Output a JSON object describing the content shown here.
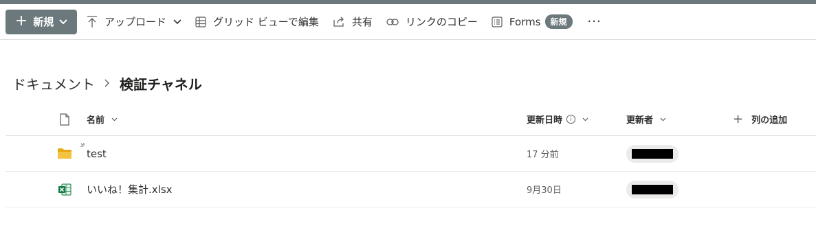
{
  "toolbar": {
    "new_label": "新規",
    "upload_label": "アップロード",
    "grid_label": "グリッド ビューで編集",
    "share_label": "共有",
    "copy_link_label": "リンクのコピー",
    "forms_label": "Forms",
    "forms_badge": "新規",
    "more_label": "···"
  },
  "breadcrumb": {
    "root": "ドキュメント",
    "current": "検証チャネル"
  },
  "columns": {
    "name": "名前",
    "modified": "更新日時",
    "modified_by": "更新者",
    "add_column": "列の追加"
  },
  "files": [
    {
      "name": "test",
      "modified": "17 分前",
      "type": "folder-icon"
    },
    {
      "name": "いいね！集計.xlsx",
      "modified": "9月30日",
      "type": "excel-icon"
    }
  ],
  "colors": {
    "accent": "#6b787c",
    "folder": "#f5c342",
    "excel": "#107c41"
  }
}
